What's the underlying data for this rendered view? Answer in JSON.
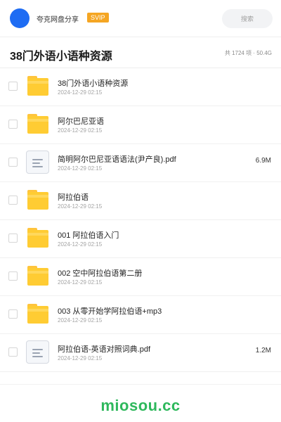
{
  "topbar": {
    "share_name": "夸克网盘分享",
    "badge": "SVIP",
    "search_placeholder": "搜索"
  },
  "header": {
    "title": "38门外语小语种资源",
    "stats": "共 1724 项 · 50.4G"
  },
  "items": [
    {
      "type": "folder",
      "name": "38门外语小语种资源",
      "date": "2024-12-29 02:15",
      "size": ""
    },
    {
      "type": "folder",
      "name": "阿尔巴尼亚语",
      "date": "2024-12-29 02:15",
      "size": ""
    },
    {
      "type": "file",
      "name": "简明阿尔巴尼亚语语法(尹产良).pdf",
      "date": "2024-12-29 02:15",
      "size": "6.9M"
    },
    {
      "type": "folder",
      "name": "阿拉伯语",
      "date": "2024-12-29 02:15",
      "size": ""
    },
    {
      "type": "folder",
      "name": "001 阿拉伯语入门",
      "date": "2024-12-29 02:15",
      "size": ""
    },
    {
      "type": "folder",
      "name": "002 空中阿拉伯语第二册",
      "date": "2024-12-29 02:15",
      "size": ""
    },
    {
      "type": "folder",
      "name": "003 从零开始学阿拉伯语+mp3",
      "date": "2024-12-29 02:15",
      "size": ""
    },
    {
      "type": "file",
      "name": "阿拉伯语-英语对照词典.pdf",
      "date": "2024-12-29 02:15",
      "size": "1.2M"
    }
  ],
  "footer": {
    "watermark": "miosou.cc"
  },
  "colors": {
    "accent": "#1e6cf3",
    "badge": "#f5a623",
    "folder": "#ffcc33",
    "watermark": "#2eb85c"
  }
}
